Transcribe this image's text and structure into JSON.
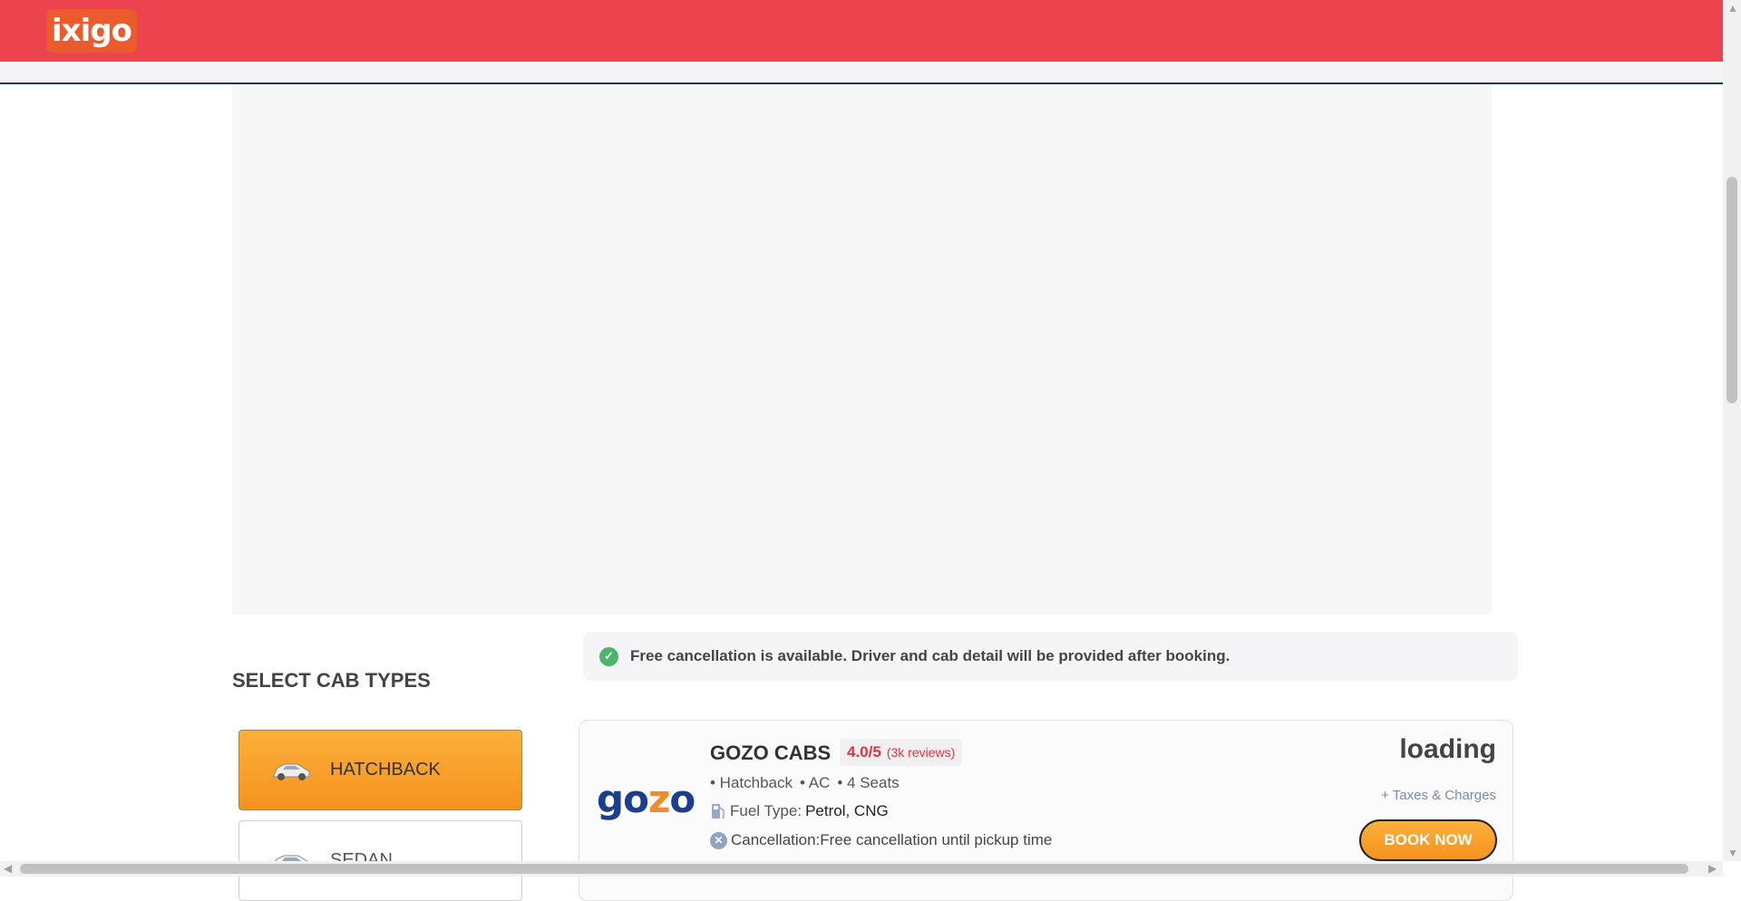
{
  "header": {
    "logo_text": "ixigo",
    "brand_color": "#eb444f"
  },
  "notice": {
    "text": "Free cancellation is available. Driver and cab detail will be provided after booking.",
    "icon": "check-circle-icon"
  },
  "cab_types": {
    "title": "SELECT CAB TYPES",
    "items": [
      {
        "label": "HATCHBACK",
        "selected": true
      },
      {
        "label": "SEDAN",
        "selected": false
      }
    ]
  },
  "cab_card": {
    "logo_text_pre": "go",
    "logo_text_z": "z",
    "logo_text_post": "o",
    "name": "GOZO CABS",
    "rating": "4.0/5",
    "reviews": "(3k reviews)",
    "features": [
      "• Hatchback",
      "• AC",
      "• 4 Seats"
    ],
    "fuel_label": "Fuel Type:",
    "fuel_value": "Petrol, CNG",
    "cancellation": "Cancellation:Free cancellation until pickup time",
    "price": "loading",
    "taxes": "+ Taxes & Charges",
    "book_label": "BOOK NOW"
  }
}
